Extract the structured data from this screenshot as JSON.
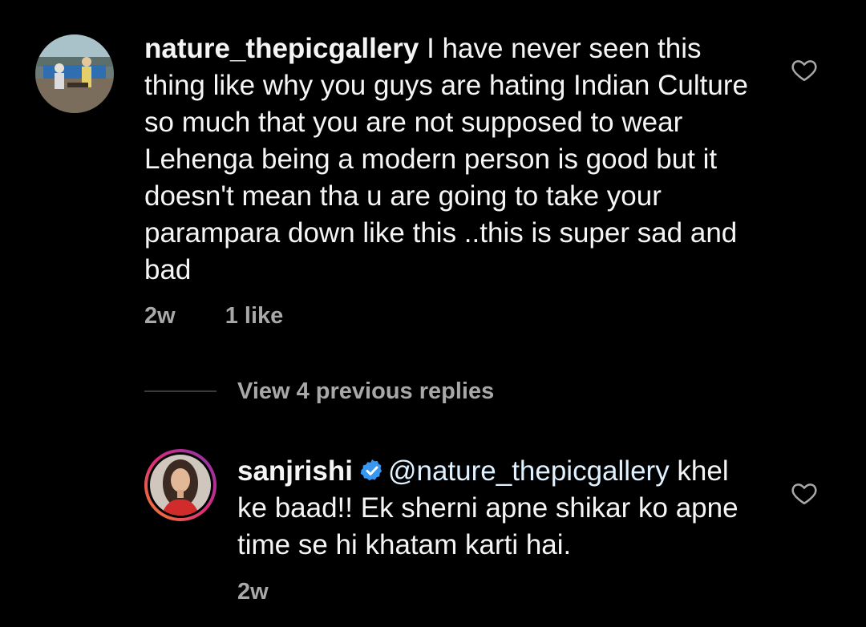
{
  "comments": [
    {
      "username": "nature_thepicgallery",
      "text": " I have never seen this thing like why you guys are hating Indian Culture so much that you are not  supposed to wear Lehenga being a modern person is good but it doesn't mean tha u are going to take your parampara down like this ..this is super sad and bad",
      "time": "2w",
      "likes": "1 like",
      "avatar_icon": "profile-photo"
    }
  ],
  "view_replies_label": "View 4 previous replies",
  "reply": {
    "username": "sanjrishi",
    "verified_icon": "verified-badge-icon",
    "mention": "@nature_thepicgallery",
    "text": " khel ke baad!! Ek sherni apne shikar ko apne time se hi khatam karti hai.",
    "time": "2w",
    "avatar_icon": "profile-photo"
  },
  "colors": {
    "background": "#000000",
    "secondary_text": "#a8a8a8",
    "verified": "#3897f0",
    "story_ring": "#c13584"
  }
}
